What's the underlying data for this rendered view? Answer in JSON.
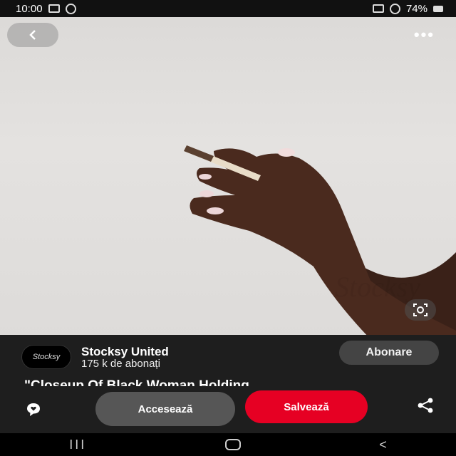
{
  "status_bar": {
    "time": "10:00",
    "battery": "74%"
  },
  "pin": {
    "title": "\"Closeup Of Black Woman Holding",
    "image_alt": "hand holding a cigarette against a light grey wall"
  },
  "publisher": {
    "name": "Stocksy United",
    "subscribers": "175 k de abonați",
    "avatar_text": "Stocksy",
    "follow_label": "Abonare"
  },
  "actions": {
    "visit_label": "Accesează",
    "save_label": "Salvează"
  },
  "nav": {
    "recent_label": "III",
    "back_label": "<"
  },
  "colors": {
    "save_button": "#e60023",
    "panel_background": "#1e1e1e",
    "visit_button": "#565656"
  },
  "icons": {
    "back": "chevron-left-icon",
    "more": "more-horizontal-icon",
    "lens": "visual-search-icon",
    "comment": "chat-bubble-heart-icon",
    "share": "share-icon"
  }
}
